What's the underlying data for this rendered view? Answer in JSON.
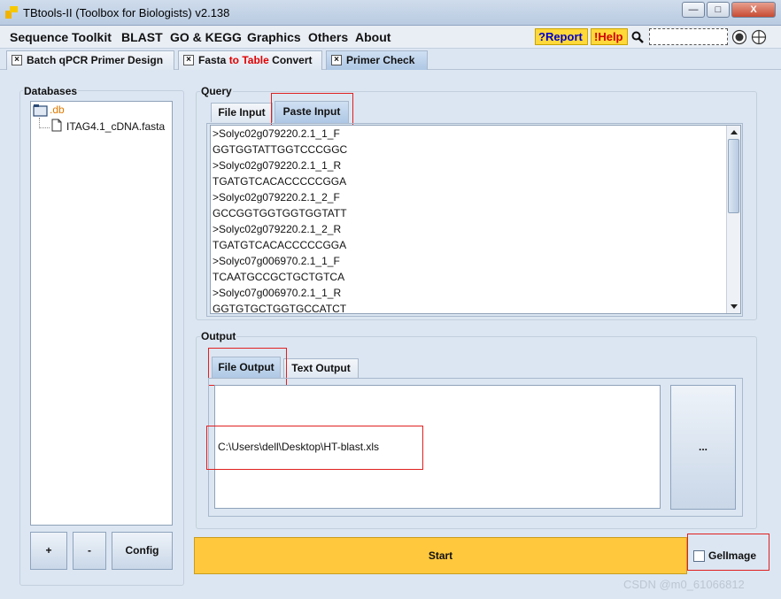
{
  "window": {
    "title": "TBtools-II (Toolbox for Biologists) v2.138",
    "minimize_label": "—",
    "maximize_label": "□",
    "close_label": "X"
  },
  "menu": {
    "items": [
      "Sequence Toolkit",
      "BLAST",
      "GO & KEGG",
      "Graphics",
      "Others",
      "About"
    ],
    "report_label": "?Report",
    "help_label": "!Help"
  },
  "tabs": {
    "batch_qpcr": "Batch qPCR Primer Design",
    "fasta_a": "Fasta ",
    "fasta_b": "to Table",
    "fasta_c": " Convert",
    "primer_check": "Primer Check"
  },
  "databases": {
    "title": "Databases",
    "root": ".db",
    "file": "ITAG4.1_cDNA.fasta",
    "add_label": "+",
    "remove_label": "-",
    "config_label": "Config"
  },
  "query": {
    "title": "Query",
    "tab_file": "File Input",
    "tab_paste": "Paste Input",
    "lines": [
      ">Solyc02g079220.2.1_1_F",
      "GGTGGTATTGGTCCCGGC",
      ">Solyc02g079220.2.1_1_R",
      "TGATGTCACACCCCCGGA",
      ">Solyc02g079220.2.1_2_F",
      "GCCGGTGGTGGTGGTATT",
      ">Solyc02g079220.2.1_2_R",
      "TGATGTCACACCCCCGGA",
      ">Solyc07g006970.2.1_1_F",
      "TCAATGCCGCTGCTGTCA",
      ">Solyc07g006970.2.1_1_R",
      "GGTGTGCTGGTGCCATCT"
    ]
  },
  "output": {
    "title": "Output",
    "tab_file": "File Output",
    "tab_text": "Text Output",
    "path": "C:\\Users\\dell\\Desktop\\HT-blast.xls",
    "browse_label": "..."
  },
  "actions": {
    "start_label": "Start",
    "gelimage_label": "GelImage"
  },
  "watermark": "CSDN @m0_61066812",
  "colors": {
    "start_bg": "#ffc83d",
    "highlight_box": "#e02020",
    "report_text": "#0000cc",
    "help_text": "#d00000"
  }
}
